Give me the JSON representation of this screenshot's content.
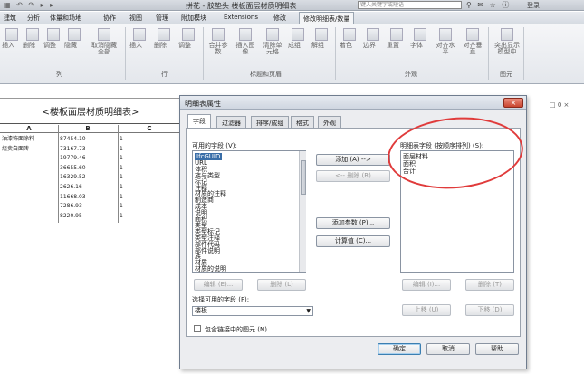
{
  "titlebar": {
    "qa_icons": "▦ ↶ ↷ ▸ ▸",
    "title": "拼花 - 胶垫头  楼板面层材质明细表",
    "search_placeholder": "键入关键字或短语",
    "tools": "⚲ ✉ ☆ ⓘ",
    "login": "登录"
  },
  "tabs": [
    {
      "label": "建筑",
      "active": false
    },
    {
      "label": "分析",
      "active": false
    },
    {
      "label": "体量和场地",
      "active": false
    },
    {
      "label": "协作",
      "active": false
    },
    {
      "label": "视图",
      "active": false
    },
    {
      "label": "管理",
      "active": false
    },
    {
      "label": "附加模块",
      "active": false
    },
    {
      "label": "Extensions",
      "active": false
    },
    {
      "label": "修改",
      "active": false
    },
    {
      "label": "修改明细表/数量",
      "active": true
    }
  ],
  "ribbon": {
    "buttons": [
      "插入",
      "删除",
      "调整",
      "隐藏",
      "取消隐藏全部",
      "插入",
      "删除",
      "调整",
      "合并参数",
      "插入图像",
      "清除单元格",
      "成组",
      "解组",
      "着色",
      "边界",
      "重置",
      "字体",
      "对齐水平",
      "对齐垂直",
      "突出显示模型中"
    ],
    "groups": [
      "列",
      "行",
      "标题和页眉",
      "外观",
      "图元"
    ]
  },
  "schedule": {
    "title": "<楼板面层材质明细表>",
    "columns": [
      "A",
      "B",
      "C"
    ],
    "rows": [
      [
        "油漆饰面涂料",
        "87454.10",
        "1"
      ],
      [
        "烧卖白面砖",
        "73167.73",
        "1"
      ],
      [
        "",
        "19779.46",
        "1"
      ],
      [
        "",
        "36655.60",
        "1"
      ],
      [
        "",
        "16329.52",
        "1"
      ],
      [
        "",
        "2626.16",
        "1"
      ],
      [
        "",
        "11668.03",
        "1"
      ],
      [
        "",
        "7286.93",
        "1"
      ],
      [
        "",
        "8220.95",
        "1"
      ]
    ]
  },
  "right_mark": "□ 0 ×",
  "dialog": {
    "title": "明细表属性",
    "close_label": "×",
    "tabs": [
      "字段",
      "过滤器",
      "排序/成组",
      "格式",
      "外观"
    ],
    "available_label": "可用的字段 (V):",
    "available_fields": [
      "IfcGUID",
      "URL",
      "体积",
      "族与类型",
      "标记",
      "注释",
      "材质的注释",
      "制造商",
      "成本",
      "说明",
      "面积",
      "类型",
      "类型标记",
      "类型注释",
      "部件代码",
      "部件说明",
      "族",
      "材质",
      "材质的说明"
    ],
    "add_button": "添加 (A) -->",
    "remove_button": "<-- 删除 (R)",
    "add_param_button": "添加参数 (P)...",
    "calc_button": "计算值 (C)...",
    "scheduled_label": "明细表字段 (按顺序排列) (S):",
    "scheduled_fields": [
      "面层材料",
      "面积",
      "合计"
    ],
    "edit_left": "编辑 (E)...",
    "delete_left": "删除 (L)",
    "edit_right": "编辑 (I)...",
    "delete_right": "删除 (T)",
    "up_button": "上移 (U)",
    "down_button": "下移 (D)",
    "select_from_label": "选择可用的字段 (F):",
    "select_from_value": "楼板",
    "include_links_label": "包含链接中的图元 (N)",
    "ok": "确定",
    "cancel": "取消",
    "help": "帮助"
  }
}
